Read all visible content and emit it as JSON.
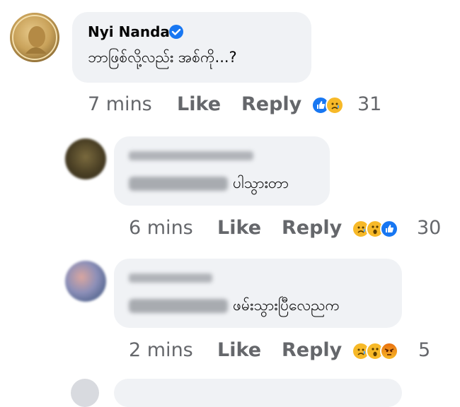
{
  "comments": [
    {
      "author": "Nyi Nanda",
      "verified": true,
      "text": "ဘာဖြစ်လို့လည်း အစ်ကို...?",
      "time": "7 mins",
      "like": "Like",
      "reply": "Reply",
      "reaction_icons": [
        "like-reaction",
        "sad-reaction"
      ],
      "reaction_count": "31"
    },
    {
      "author": "",
      "text": "ပါသွားတာ",
      "time": "6 mins",
      "like": "Like",
      "reply": "Reply",
      "reaction_icons": [
        "sad-reaction",
        "wow-reaction",
        "like-reaction"
      ],
      "reaction_count": "30"
    },
    {
      "author": "",
      "text": "ဖမ်းသွားပြီလေညက",
      "time": "2 mins",
      "like": "Like",
      "reply": "Reply",
      "reaction_icons": [
        "sad-reaction",
        "wow-reaction",
        "angry-reaction"
      ],
      "reaction_count": "5"
    }
  ],
  "colors": {
    "bubble": "#f0f2f5",
    "meta_text": "#65676b",
    "verified": "#1877f2",
    "like_reaction": "#1877f2",
    "reaction_yellow": "#f7b928",
    "angry_reaction": "#e9710f"
  }
}
